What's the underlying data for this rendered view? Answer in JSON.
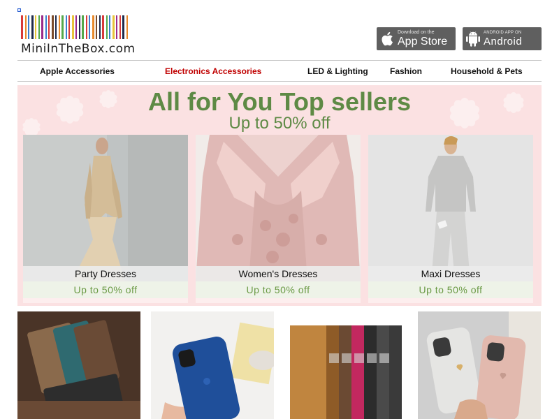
{
  "logo": {
    "text": "MiniInTheBox.com",
    "bar_colors": [
      "#d83a3a",
      "#e98a2c",
      "#3a7fd0",
      "#1f2a4a",
      "#e7c43a",
      "#55a84b",
      "#9b2b8a",
      "#3a7fd0",
      "#d83a3a",
      "#7a4b2a",
      "#1f2a4a",
      "#e98a2c",
      "#55a84b",
      "#3a7fd0",
      "#d83a3a",
      "#e7c43a",
      "#9b2b8a",
      "#1f2a4a",
      "#55a84b",
      "#d83a3a",
      "#3a7fd0",
      "#e98a2c",
      "#7a4b2a",
      "#1f2a4a",
      "#d83a3a",
      "#55a84b",
      "#3a7fd0",
      "#e7c43a",
      "#9b2b8a",
      "#d83a3a",
      "#1f2a4a",
      "#e98a2c"
    ]
  },
  "apps": {
    "apple": {
      "small": "Download on the",
      "big": "App Store",
      "icon": "apple-icon"
    },
    "android": {
      "small": "ANDROID APP ON",
      "big": "Android",
      "icon": "android-icon"
    }
  },
  "nav": {
    "items": [
      {
        "label": "Apple Accessories"
      },
      {
        "label": "Electronics Accessories",
        "active": true
      },
      {
        "label": "LED & Lighting"
      },
      {
        "label": "Fashion"
      },
      {
        "label": "Household & Pets"
      }
    ]
  },
  "hero": {
    "title": "All for You Top sellers",
    "subtitle": "Up to 50% off",
    "cards": [
      {
        "name": "Party Dresses",
        "offer": "Up to 50% off"
      },
      {
        "name": "Women's Dresses",
        "offer": "Up to 50% off"
      },
      {
        "name": "Maxi Dresses",
        "offer": "Up to 50% off"
      }
    ]
  },
  "colors": {
    "accent_green": "#5e8a45",
    "nav_active": "#c00000",
    "badge_bg": "#5f5f5f"
  }
}
